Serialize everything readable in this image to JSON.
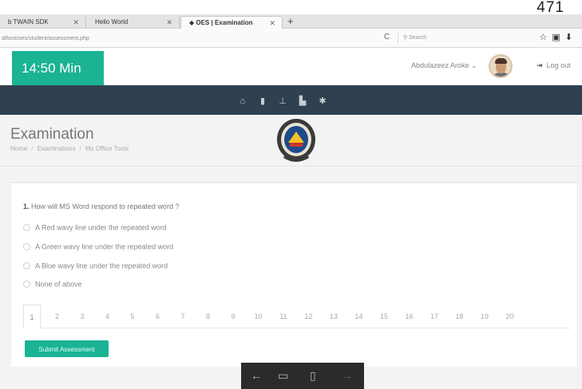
{
  "page_number": "471",
  "browser": {
    "tabs": [
      {
        "label": "b TWAIN SDK"
      },
      {
        "label": "Hello World"
      },
      {
        "label": "OES | Examination"
      }
    ],
    "new_tab": "+",
    "url": "alhost/oes/student/assessment.php",
    "search_placeholder": "Search"
  },
  "header": {
    "timer": "14:50 Min",
    "user": "Abdulazeez Aroke",
    "logout": "Log out"
  },
  "nav": {
    "icons": [
      "home-icon",
      "file-icon",
      "user-icon",
      "book-icon",
      "gear-icon"
    ]
  },
  "title": {
    "heading": "Examination",
    "breadcrumbs": [
      "Home",
      "Examinations",
      "Ms Office Tools"
    ]
  },
  "question": {
    "number": "1.",
    "text": "How will MS Word respond to repeated word ?",
    "options": [
      "A Red wavy line under the repeated word",
      "A Green wavy line under the repeated word",
      "A Blue wavy line under the repeated word",
      "None of above"
    ]
  },
  "pagination": [
    "1",
    "2",
    "3",
    "4",
    "5",
    "6",
    "7",
    "8",
    "9",
    "10",
    "11",
    "12",
    "13",
    "14",
    "15",
    "16",
    "17",
    "18",
    "19",
    "20"
  ],
  "submit_label": "Submit Assessment",
  "accent_color": "#1ab394",
  "nav_color": "#2f4050"
}
